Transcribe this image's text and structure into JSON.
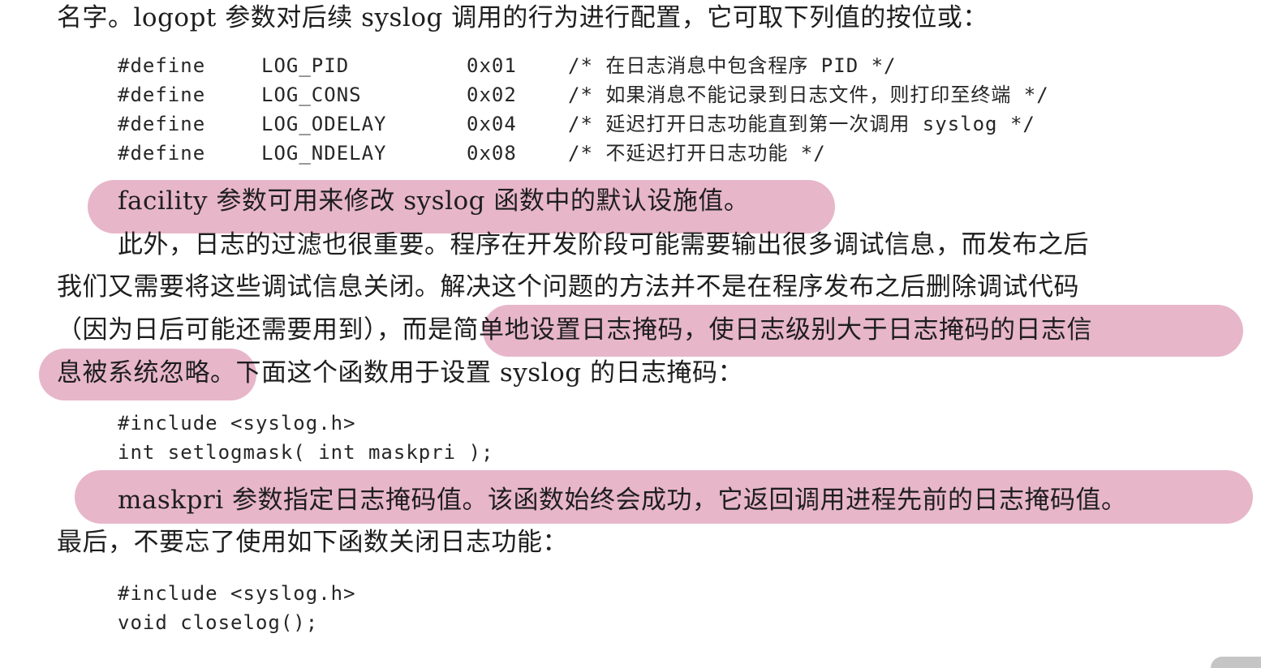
{
  "colors": {
    "highlight": "#e7b6c9",
    "text": "#1e1e1e",
    "page_background": "#ffffff"
  },
  "top_line": "名字。logopt 参数对后续 syslog 调用的行为进行配置，它可取下列值的按位或：",
  "define_table": [
    {
      "keyword": "#define",
      "name": "LOG_PID",
      "value": "0x01",
      "comment": "/* 在日志消息中包含程序 PID */"
    },
    {
      "keyword": "#define",
      "name": "LOG_CONS",
      "value": "0x02",
      "comment": "/* 如果消息不能记录到日志文件，则打印至终端 */"
    },
    {
      "keyword": "#define",
      "name": "LOG_ODELAY",
      "value": "0x04",
      "comment": "/* 延迟打开日志功能直到第一次调用 syslog */"
    },
    {
      "keyword": "#define",
      "name": "LOG_NDELAY",
      "value": "0x08",
      "comment": "/* 不延迟打开日志功能 */"
    }
  ],
  "facility_line": "facility 参数可用来修改 syslog 函数中的默认设施值。",
  "paragraph_filter": {
    "line1": "此外，日志的过滤也很重要。程序在开发阶段可能需要输出很多调试信息，而发布之后",
    "line2": "我们又需要将这些调试信息关闭。解决这个问题的方法并不是在程序发布之后删除调试代码",
    "line3": "（因为日后可能还需要用到），而是简单地设置日志掩码，使日志级别大于日志掩码的日志信",
    "line4": "息被系统忽略。下面这个函数用于设置 syslog 的日志掩码："
  },
  "code_setlogmask": {
    "line1": "#include <syslog.h>",
    "line2": "int setlogmask( int maskpri );"
  },
  "maskpri_line": "maskpri 参数指定日志掩码值。该函数始终会成功，它返回调用进程先前的日志掩码值。",
  "closing_line": "最后，不要忘了使用如下函数关闭日志功能：",
  "code_closelog": {
    "line1": "#include <syslog.h>",
    "line2": "void closelog();"
  }
}
